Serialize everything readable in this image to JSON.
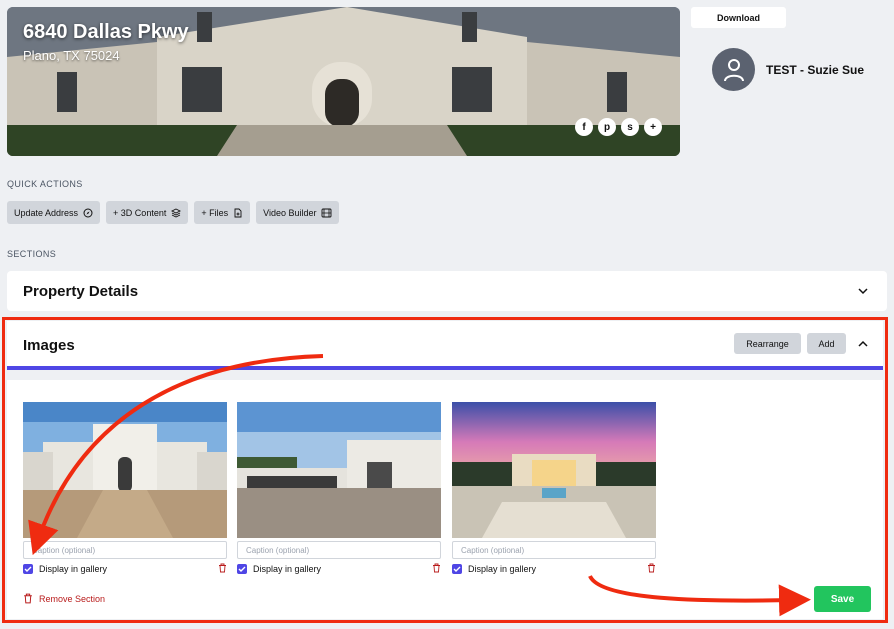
{
  "property": {
    "address": "6840 Dallas Pkwy",
    "city_state_zip": "Plano, TX 75024"
  },
  "social": [
    "f",
    "p",
    "s",
    "+"
  ],
  "header": {
    "download_label": "Download",
    "user_name": "TEST - Suzie Sue"
  },
  "quick_actions": {
    "label": "QUICK ACTIONS",
    "items": [
      {
        "label": "Update Address",
        "icon": "compass-icon"
      },
      {
        "label": "+ 3D Content",
        "icon": "layers-icon"
      },
      {
        "label": "+ Files",
        "icon": "file-plus-icon"
      },
      {
        "label": "Video Builder",
        "icon": "film-icon"
      }
    ]
  },
  "sections": {
    "label": "SECTIONS",
    "property_details": {
      "title": "Property Details"
    },
    "images": {
      "title": "Images",
      "rearrange_label": "Rearrange",
      "add_label": "Add",
      "caption_placeholder": "Caption (optional)",
      "gallery_label": "Display in gallery",
      "cards": [
        {
          "display_in_gallery": true
        },
        {
          "display_in_gallery": true
        },
        {
          "display_in_gallery": true
        }
      ],
      "remove_label": "Remove Section",
      "save_label": "Save"
    }
  },
  "colors": {
    "accent": "#4f46e5",
    "save": "#22c55e",
    "danger": "#b91c1c",
    "annotation": "#ef2b10"
  }
}
